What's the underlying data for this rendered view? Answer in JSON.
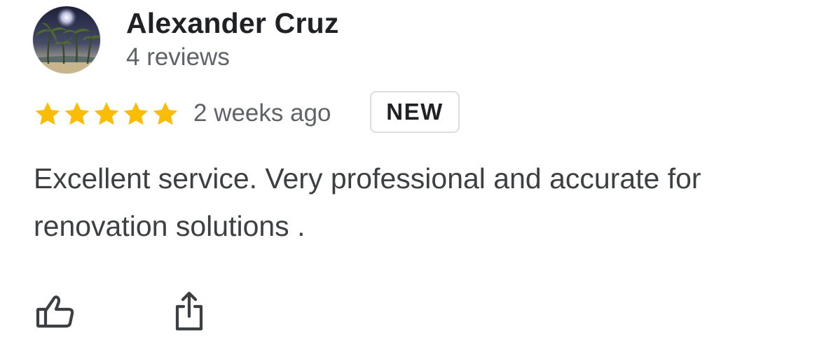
{
  "review": {
    "author_name": "Alexander Cruz",
    "author_reviews": "4 reviews",
    "rating": 5,
    "rating_max": 5,
    "time_ago": "2 weeks ago",
    "badge": "NEW",
    "text": "Excellent service. Very professional and accurate for renovation solutions ."
  },
  "actions": {
    "like_icon": "thumbs-up-outline",
    "share_icon": "share-upload"
  },
  "colors": {
    "star": "#FBBC04",
    "secondary_text": "#5f6368",
    "badge_border": "#dadce0"
  }
}
